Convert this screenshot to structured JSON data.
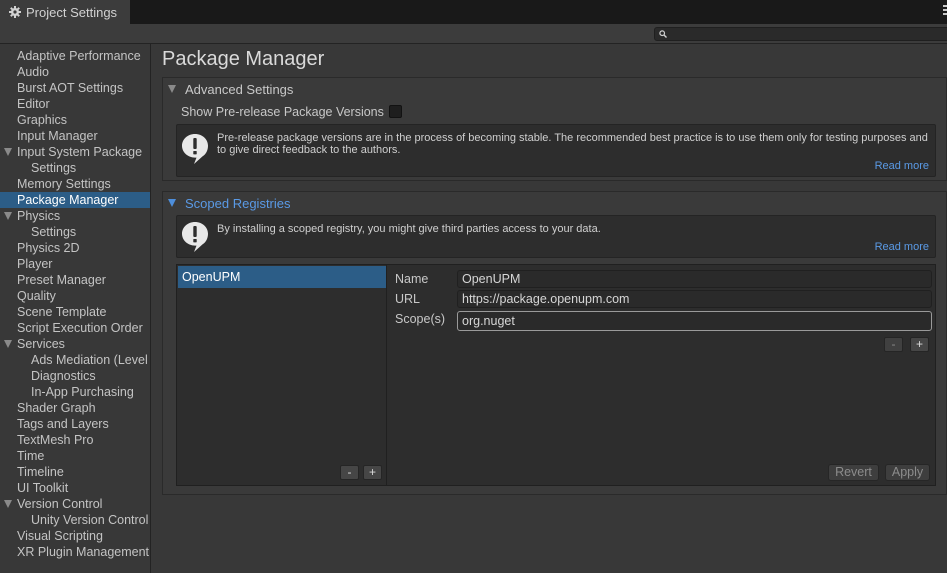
{
  "window": {
    "tab_title": "Project Settings"
  },
  "search": {
    "placeholder": ""
  },
  "sidebar": {
    "items": [
      {
        "label": "Adaptive Performance"
      },
      {
        "label": "Audio"
      },
      {
        "label": "Burst AOT Settings"
      },
      {
        "label": "Editor"
      },
      {
        "label": "Graphics"
      },
      {
        "label": "Input Manager"
      },
      {
        "label": "Input System Package"
      },
      {
        "label": "Settings"
      },
      {
        "label": "Memory Settings"
      },
      {
        "label": "Package Manager"
      },
      {
        "label": "Physics"
      },
      {
        "label": "Settings"
      },
      {
        "label": "Physics 2D"
      },
      {
        "label": "Player"
      },
      {
        "label": "Preset Manager"
      },
      {
        "label": "Quality"
      },
      {
        "label": "Scene Template"
      },
      {
        "label": "Script Execution Order"
      },
      {
        "label": "Services"
      },
      {
        "label": "Ads Mediation (Level"
      },
      {
        "label": "Diagnostics"
      },
      {
        "label": "In-App Purchasing"
      },
      {
        "label": "Shader Graph"
      },
      {
        "label": "Tags and Layers"
      },
      {
        "label": "TextMesh Pro"
      },
      {
        "label": "Time"
      },
      {
        "label": "Timeline"
      },
      {
        "label": "UI Toolkit"
      },
      {
        "label": "Version Control"
      },
      {
        "label": "Unity Version Control"
      },
      {
        "label": "Visual Scripting"
      },
      {
        "label": "XR Plugin Management"
      }
    ]
  },
  "main": {
    "title": "Package Manager",
    "advanced": {
      "title": "Advanced Settings",
      "prerelease_label": "Show Pre-release Package Versions",
      "prerelease_checked": false,
      "help_text": "Pre-release package versions are in the process of becoming stable. The recommended best practice is to use them only for testing purposes and to give direct feedback to the authors.",
      "read_more": "Read more"
    },
    "scoped": {
      "title": "Scoped Registries",
      "help_text": "By installing a scoped registry, you might give third parties access to your data.",
      "read_more": "Read more",
      "registries": [
        {
          "name": "OpenUPM"
        }
      ],
      "list_remove": "-",
      "list_add": "+",
      "detail": {
        "name_label": "Name",
        "name_value": "OpenUPM",
        "url_label": "URL",
        "url_value": "https://package.openupm.com",
        "scopes_label": "Scope(s)",
        "scopes_value": "org.nuget",
        "scope_remove": "-",
        "scope_add": "+",
        "revert": "Revert",
        "apply": "Apply"
      }
    }
  }
}
